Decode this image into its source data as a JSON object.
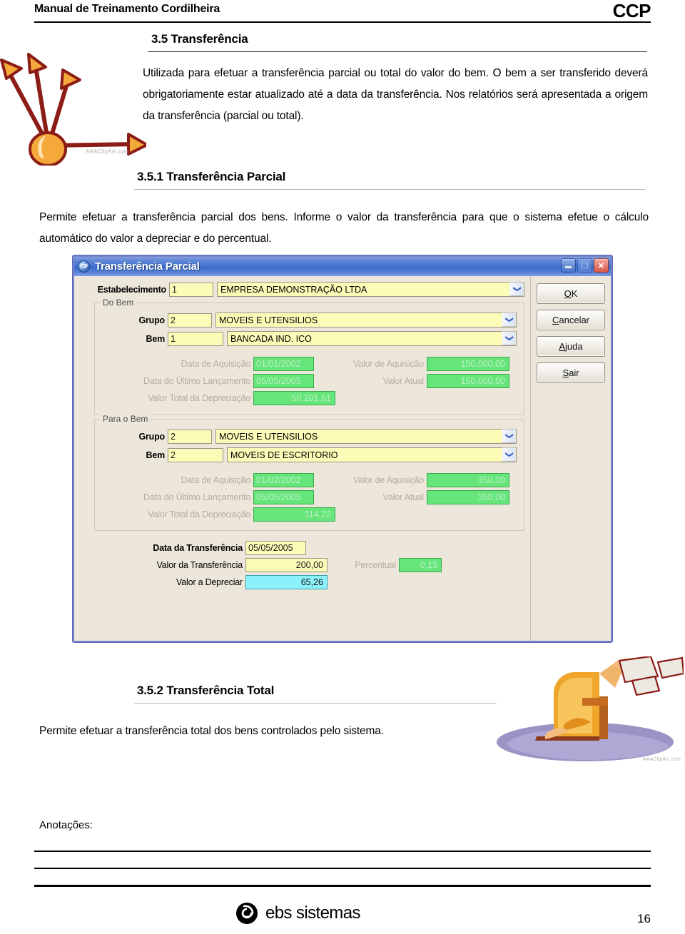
{
  "header": {
    "title": "Manual de Treinamento Cordilheira",
    "brand": "CCP"
  },
  "sections": {
    "s35": {
      "heading": "3.5 Transferência",
      "body": "Utilizada para efetuar a transferência parcial ou total do valor do bem. O bem a ser transferido deverá obrigatoriamente estar atualizado até a data da transferência. Nos  relatórios será apresentada a origem da transferência (parcial ou total)."
    },
    "s351": {
      "heading": "3.5.1 Transferência Parcial",
      "body": "Permite efetuar a transferência parcial dos bens. Informe o valor da transferência para que o sistema efetue o cálculo automático do valor a depreciar e do percentual."
    },
    "s352": {
      "heading": "3.5.2 Transferência Total",
      "body": "Permite efetuar a transferência total dos bens controlados pelo sistema."
    }
  },
  "clipart": {
    "arrows_caption": "AAAClipArt.com",
    "papers_caption": "AAAClipArt.com"
  },
  "dialog": {
    "title": "Transferência Parcial",
    "window_buttons": {
      "minimize": "minimize-icon",
      "maximize": "maximize-icon",
      "close": "close-icon"
    },
    "establishment": {
      "label": "Estabelecimento",
      "code": "1",
      "name": "EMPRESA DEMONSTRAÇÃO LTDA"
    },
    "do_bem": {
      "legend": "Do Bem",
      "grupo_label": "Grupo",
      "grupo_code": "2",
      "grupo_name": "MOVEIS E UTENSILIOS",
      "bem_label": "Bem",
      "bem_code": "1",
      "bem_name": "BANCADA IND. ICO",
      "data_aquisicao_label": "Data de Aquisição",
      "data_aquisicao_value": "01/01/2002",
      "valor_aquisicao_label": "Valor de Aquisição",
      "valor_aquisicao_value": "150.000,00",
      "data_ultimo_label": "Data do Último Lançamento",
      "data_ultimo_value": "05/05/2005",
      "valor_atual_label": "Valor Atual",
      "valor_atual_value": "150.000,00",
      "valor_depreciacao_label": "Valor Total da Depreciação",
      "valor_depreciacao_value": "50.201,61"
    },
    "para_o_bem": {
      "legend": "Para o Bem",
      "grupo_label": "Grupo",
      "grupo_code": "2",
      "grupo_name": "MOVEIS E UTENSILIOS",
      "bem_label": "Bem",
      "bem_code": "2",
      "bem_name": "MOVEIS DE ESCRITORIO",
      "data_aquisicao_label": "Data de Aquisição",
      "data_aquisicao_value": "01/02/2002",
      "valor_aquisicao_label": "Valor de Aquisição",
      "valor_aquisicao_value": "350,00",
      "data_ultimo_label": "Data do Último Lançamento",
      "data_ultimo_value": "05/05/2005",
      "valor_atual_label": "Valor Atual",
      "valor_atual_value": "350,00",
      "valor_depreciacao_label": "Valor Total da Depreciação",
      "valor_depreciacao_value": "114,22"
    },
    "transfer": {
      "data_label": "Data da Transferência",
      "data_value": "05/05/2005",
      "valor_label": "Valor da Transferência",
      "valor_value": "200,00",
      "percentual_label": "Percentual",
      "percentual_value": "0,13",
      "depreciar_label": "Valor a Depreciar",
      "depreciar_value": "65,26"
    },
    "buttons": {
      "ok": "OK",
      "cancelar": "Cancelar",
      "ajuda": "Ajuda",
      "sair": "Sair"
    }
  },
  "footer": {
    "anotacoes_label": "Anotações:",
    "logo_text": "ebs sistemas",
    "page_number": "16"
  },
  "colors": {
    "field_yellow": "#fcfcb8",
    "field_green": "#66e57a",
    "field_cyan": "#8bf2fb",
    "dialog_bg": "#ece7da",
    "titlebar_blue": "#3a6ccc",
    "clipart_orange": "#f0992e",
    "clipart_darkred": "#8c1c16",
    "clipart_purple": "#9a93c4"
  }
}
